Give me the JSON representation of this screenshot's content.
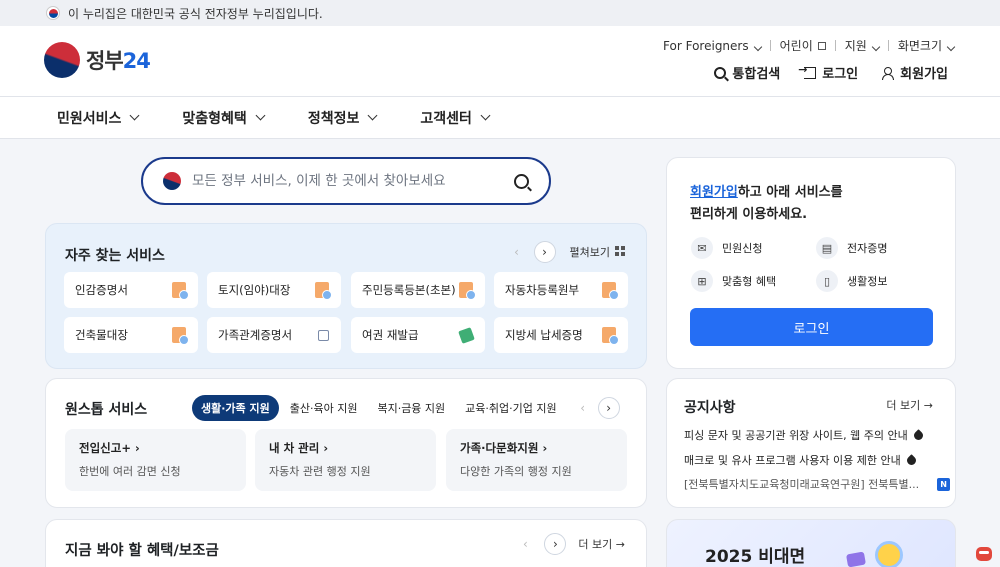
{
  "gov_banner": {
    "text": "이 누리집은 대한민국 공식 전자정부 누리집입니다."
  },
  "logo": {
    "name": "정부",
    "num": "24"
  },
  "util_menu": [
    {
      "label": "For Foreigners",
      "icon": "chevron-down-icon"
    },
    {
      "label": "어린이",
      "icon": "external-link-icon"
    },
    {
      "label": "지원",
      "icon": "chevron-down-icon"
    },
    {
      "label": "화면크기",
      "icon": "chevron-down-icon"
    }
  ],
  "actions": {
    "search": "통합검색",
    "login": "로그인",
    "signup": "회원가입"
  },
  "nav": [
    "민원서비스",
    "맞춤형혜택",
    "정책정보",
    "고객센터"
  ],
  "search": {
    "placeholder": "모든 정부 서비스, 이제 한 곳에서 찾아보세요"
  },
  "frequent": {
    "title": "자주 찾는 서비스",
    "expand": "펼쳐보기",
    "items": [
      {
        "label": "인감증명서",
        "icon": "document-icon"
      },
      {
        "label": "토지(임야)대장",
        "icon": "document-icon"
      },
      {
        "label": "주민등록등본(초본)",
        "icon": "document-icon"
      },
      {
        "label": "자동차등록원부",
        "icon": "document-icon"
      },
      {
        "label": "건축물대장",
        "icon": "document-icon"
      },
      {
        "label": "가족관계증명서",
        "icon": "external-link-icon"
      },
      {
        "label": "여권 재발급",
        "icon": "pencil-icon"
      },
      {
        "label": "지방세 납세증명",
        "icon": "document-icon"
      }
    ]
  },
  "onestop": {
    "title": "원스톱 서비스",
    "tabs": [
      "생활·가족 지원",
      "출산·육아 지원",
      "복지·금융 지원",
      "교육·취업·기업 지원"
    ],
    "items": [
      {
        "title": "전입신고+",
        "desc": "한번에 여러 감면 신청"
      },
      {
        "title": "내 차 관리",
        "desc": "자동차 관련 행정 지원"
      },
      {
        "title": "가족·다문화지원",
        "desc": "다양한 가족의 행정 지원"
      }
    ]
  },
  "benefit": {
    "title": "지금 봐야 할 혜택/보조금",
    "more": "더 보기"
  },
  "login_card": {
    "intro_link": "회원가입",
    "intro_rest": "하고 아래 서비스를",
    "intro_line2": "편리하게 이용하세요.",
    "features": [
      {
        "label": "민원신청",
        "icon": "mail-icon"
      },
      {
        "label": "전자증명",
        "icon": "certificate-icon"
      },
      {
        "label": "맞춤형 혜택",
        "icon": "gift-icon"
      },
      {
        "label": "생활정보",
        "icon": "bookmark-icon"
      }
    ],
    "button": "로그인"
  },
  "notice": {
    "title": "공지사항",
    "more": "더 보기",
    "items": [
      {
        "text": "피싱 문자 및 공공기관 위장 사이트, 웹 주의 안내"
      },
      {
        "text": "매크로 및 유사 프로그램 사용자 이용 제한 안내"
      },
      {
        "text": "[전북특별자치도교육청미래교육연구원] 전북특별...",
        "badge": "N"
      }
    ]
  },
  "promo": {
    "title": "2025 비대면"
  },
  "colors": {
    "primary": "#256ef4",
    "navy": "#0e3a78",
    "accent_red": "#cd2e3a"
  }
}
